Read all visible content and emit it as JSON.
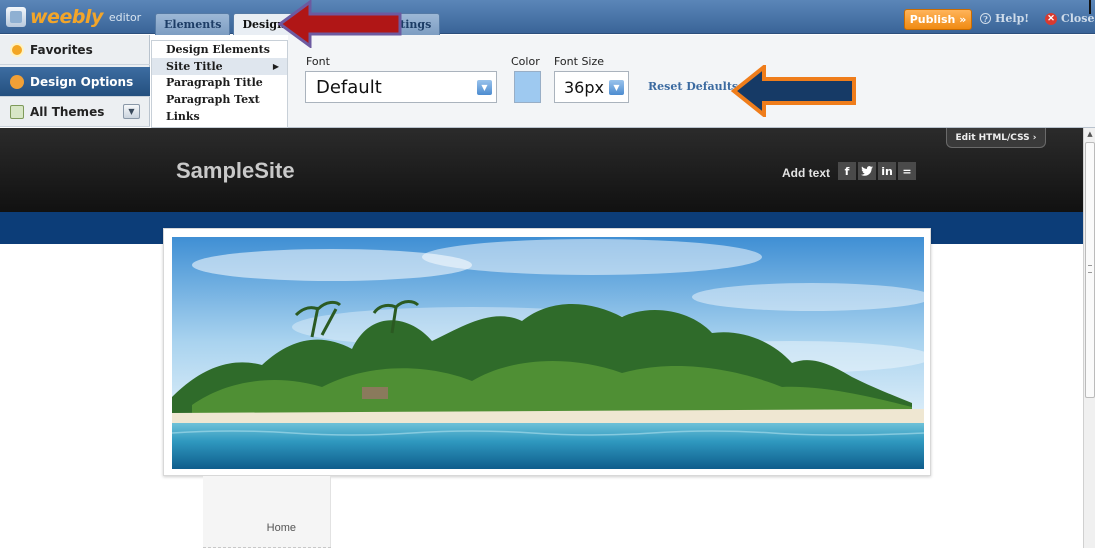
{
  "app": {
    "logo_word": "weebly",
    "logo_suffix": "editor"
  },
  "top_tabs": {
    "elements": "Elements",
    "design": "Design",
    "settings": "ttings"
  },
  "top_actions": {
    "publish": "Publish »",
    "help": "Help!",
    "close": "Close"
  },
  "sidebar": {
    "items": [
      {
        "label": "Favorites"
      },
      {
        "label": "Design Options",
        "active": true
      },
      {
        "label": "All Themes"
      }
    ]
  },
  "submenu": {
    "items": [
      {
        "label": "Design Elements"
      },
      {
        "label": "Site Title",
        "active": true,
        "has_arrow": true
      },
      {
        "label": "Paragraph Title"
      },
      {
        "label": "Paragraph Text"
      },
      {
        "label": "Links"
      }
    ],
    "arrow": "▶"
  },
  "options": {
    "font_label": "Font",
    "font_value": "Default",
    "color_label": "Color",
    "color_value": "#9ec9f0",
    "size_label": "Font Size",
    "size_value": "36px",
    "reset": "Reset Defaults"
  },
  "site": {
    "title": "SampleSite",
    "add_text": "Add text",
    "socials": [
      "f",
      "y",
      "in",
      "="
    ],
    "edit_html": "Edit HTML/CSS ›",
    "nav_home": "Home"
  },
  "colors": {
    "topbar": "#3a6498",
    "publish": "#f08a12",
    "band": "#0c3d78",
    "annot_red": "#b01616",
    "annot_orange": "#ef7d1b",
    "annot_navy": "#163a66"
  }
}
